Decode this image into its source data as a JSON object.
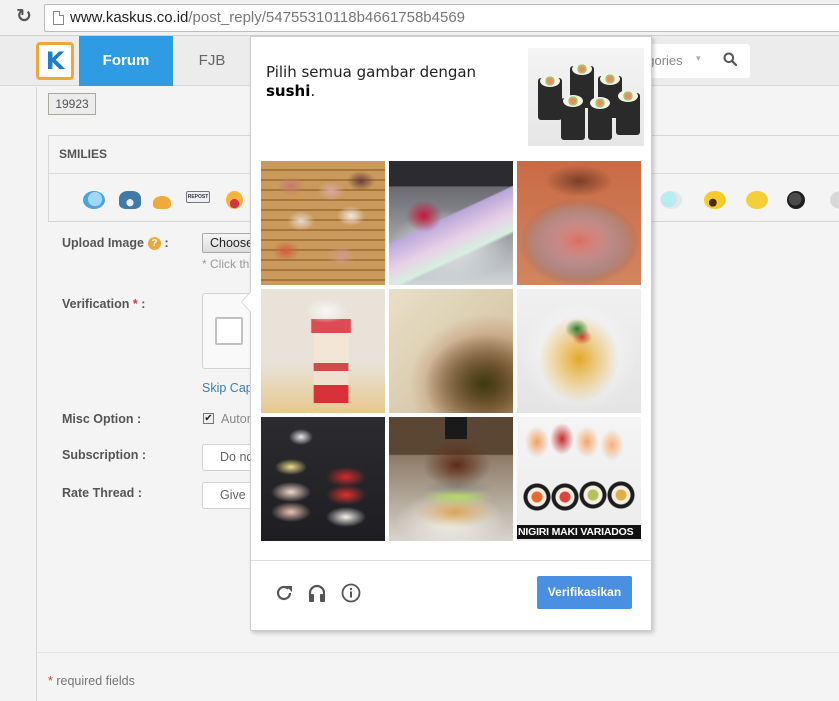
{
  "browser": {
    "url_host": "www.kaskus.co.id",
    "url_path": "/post_reply/54755310118b4661758b4569"
  },
  "header": {
    "logo_letter": "K",
    "nav": [
      {
        "label": "Forum",
        "active": true
      },
      {
        "label": "FJB",
        "active": false
      }
    ],
    "search": {
      "categories_label": "egories",
      "caret": "▾"
    }
  },
  "form": {
    "char_counter": "19923",
    "smilies_title": "SMILIES",
    "smilies": [
      "cendol-fish",
      "blue-monster",
      "orange-blob",
      "repost",
      "laughing",
      "sick-mask",
      "shouting",
      "confused",
      "black-rose",
      "grey-face"
    ],
    "upload_label": "Upload Image",
    "help_glyph": "?",
    "upload_separator": " :",
    "choose_button": "Choose",
    "click_hint": "* Click th",
    "verification_label": "Verification",
    "verification_star": " *",
    "verification_separator": " :",
    "skip_captcha": "Skip Cap",
    "misc_label": "Misc Option :",
    "misc_auto_label": "Autom",
    "misc_checked": true,
    "subscription_label": "Subscription :",
    "subscription_value": "Do no",
    "rate_label": "Rate Thread :",
    "rate_value": "Give r",
    "required_star": "*",
    "required_note": " required fields"
  },
  "challenge": {
    "prompt_text": "Pilih semua gambar dengan",
    "prompt_keyword": "sushi",
    "prompt_end": ".",
    "tiles": [
      {
        "subject": "sashimi platter",
        "caption": ""
      },
      {
        "subject": "rainbow crepe cake",
        "caption": ""
      },
      {
        "subject": "noodle soup bowl",
        "caption": ""
      },
      {
        "subject": "strawberry parfait",
        "caption": ""
      },
      {
        "subject": "clay pot soup",
        "caption": ""
      },
      {
        "subject": "curry dish",
        "caption": ""
      },
      {
        "subject": "nigiri assortment",
        "caption": ""
      },
      {
        "subject": "burger",
        "caption": ""
      },
      {
        "subject": "nigiri and maki",
        "caption": "NIGIRI MAKI VARIADOS"
      }
    ],
    "verify_button": "Verifikasikan",
    "footer_icons": [
      "reload-icon",
      "audio-icon",
      "info-icon"
    ]
  },
  "colors": {
    "brand_blue": "#2f9be3",
    "logo_orange": "#f0a73a",
    "verify_blue": "#4a90e2",
    "required_red": "#d23c3c",
    "link_blue": "#3a7fb8"
  }
}
